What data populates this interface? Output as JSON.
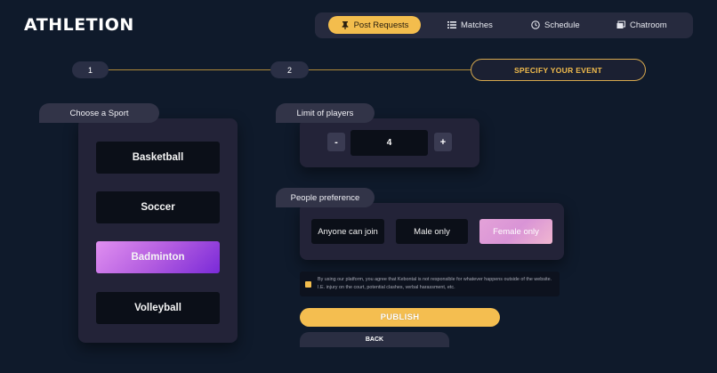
{
  "brand": {
    "name": "ATHLETION"
  },
  "nav": {
    "items": [
      {
        "label": "Post Requests",
        "icon": "pin-icon",
        "active": true
      },
      {
        "label": "Matches",
        "icon": "list-icon",
        "active": false
      },
      {
        "label": "Schedule",
        "icon": "clock-icon",
        "active": false
      },
      {
        "label": "Chatroom",
        "icon": "chat-icon",
        "active": false
      }
    ]
  },
  "steps": [
    {
      "label": "1"
    },
    {
      "label": "2"
    },
    {
      "label": "SPECIFY YOUR EVENT",
      "current": true
    }
  ],
  "sport": {
    "title": "Choose a Sport",
    "options": [
      "Basketball",
      "Soccer",
      "Badminton",
      "Volleyball"
    ],
    "selected": "Badminton"
  },
  "limit": {
    "title": "Limit of players",
    "minus_label": "-",
    "plus_label": "+",
    "value": "4"
  },
  "preference": {
    "title": "People preference",
    "options": [
      "Anyone can join",
      "Male only",
      "Female only"
    ],
    "selected": "Female only"
  },
  "terms": {
    "checked": true,
    "text": "By using our platform, you agree that Kebontal is not responsible for whatever happens outside of the website. I.E. injury on the court, potential clashes, verbal harassment, etc."
  },
  "actions": {
    "publish_label": "PUBLISH",
    "back_label": "BACK"
  },
  "colors": {
    "background": "#0f1a2b",
    "accent": "#f3bd4d",
    "selected_sport": "#b35de0",
    "selected_preference": "#e4a2d8"
  }
}
